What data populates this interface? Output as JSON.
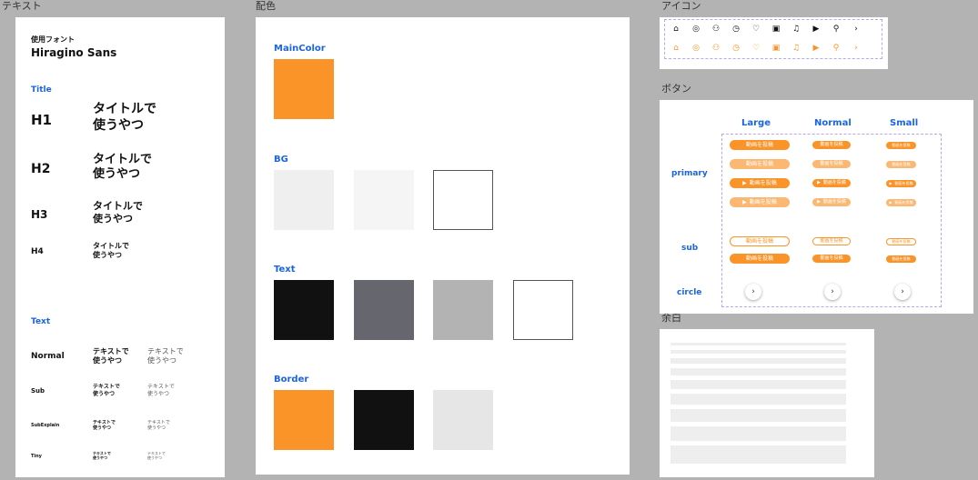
{
  "frames": {
    "text": "テキスト",
    "colors": "配色",
    "icons": "アイコン",
    "buttons": "ボタン",
    "spacing": "余白"
  },
  "text_panel": {
    "font_label": "使用フォント",
    "font_name": "Hiragino Sans",
    "title_section": "Title",
    "headings": [
      {
        "label": "H1",
        "sample_line1": "タイトルで",
        "sample_line2": "使うやつ"
      },
      {
        "label": "H2",
        "sample_line1": "タイトルで",
        "sample_line2": "使うやつ"
      },
      {
        "label": "H3",
        "sample_line1": "タイトルで",
        "sample_line2": "使うやつ"
      },
      {
        "label": "H4",
        "sample_line1": "タイトルで",
        "sample_line2": "使うやつ"
      }
    ],
    "text_section": "Text",
    "texts": [
      {
        "label": "Normal",
        "line1": "テキストで",
        "line2": "使うやつ"
      },
      {
        "label": "Sub",
        "line1": "テキストで",
        "line2": "使うやつ"
      },
      {
        "label": "SubExplain",
        "line1": "テキストで",
        "line2": "使うやつ"
      },
      {
        "label": "Tiny",
        "line1": "テキストで",
        "line2": "使うやつ"
      }
    ]
  },
  "color_panel": {
    "main_label": "MainColor",
    "bg_label": "BG",
    "text_label": "Text",
    "border_label": "Border",
    "main_colors": [
      "#fb9428"
    ],
    "bg_colors": [
      "#efeff0",
      "#f5f5f5",
      "#ffffff"
    ],
    "text_colors": [
      "#111111",
      "#66666e",
      "#b3b3b3",
      "#ffffff"
    ],
    "border_colors": [
      "#fb9428",
      "#111111",
      "#e6e6e6"
    ]
  },
  "icons": {
    "names": [
      "home-icon",
      "compass-icon",
      "people-icon",
      "clock-icon",
      "heart-icon",
      "profile-card-icon",
      "bell-icon",
      "video-camera-icon",
      "search-icon",
      "chevron-right-icon"
    ],
    "glyphs": [
      "⌂",
      "◎",
      "⚇",
      "◷",
      "♡",
      "▣",
      "♫",
      "▶",
      "⚲",
      "›"
    ],
    "default_color": "#111111",
    "active_color": "#fb9428"
  },
  "buttons": {
    "col_large": "Large",
    "col_normal": "Normal",
    "col_small": "Small",
    "row_primary": "primary",
    "row_sub": "sub",
    "row_circle": "circle",
    "label": "動画を投稿",
    "circle_glyph": "›",
    "orange": "#fb9428",
    "orange_light": "#fbb873"
  },
  "spacing": {}
}
